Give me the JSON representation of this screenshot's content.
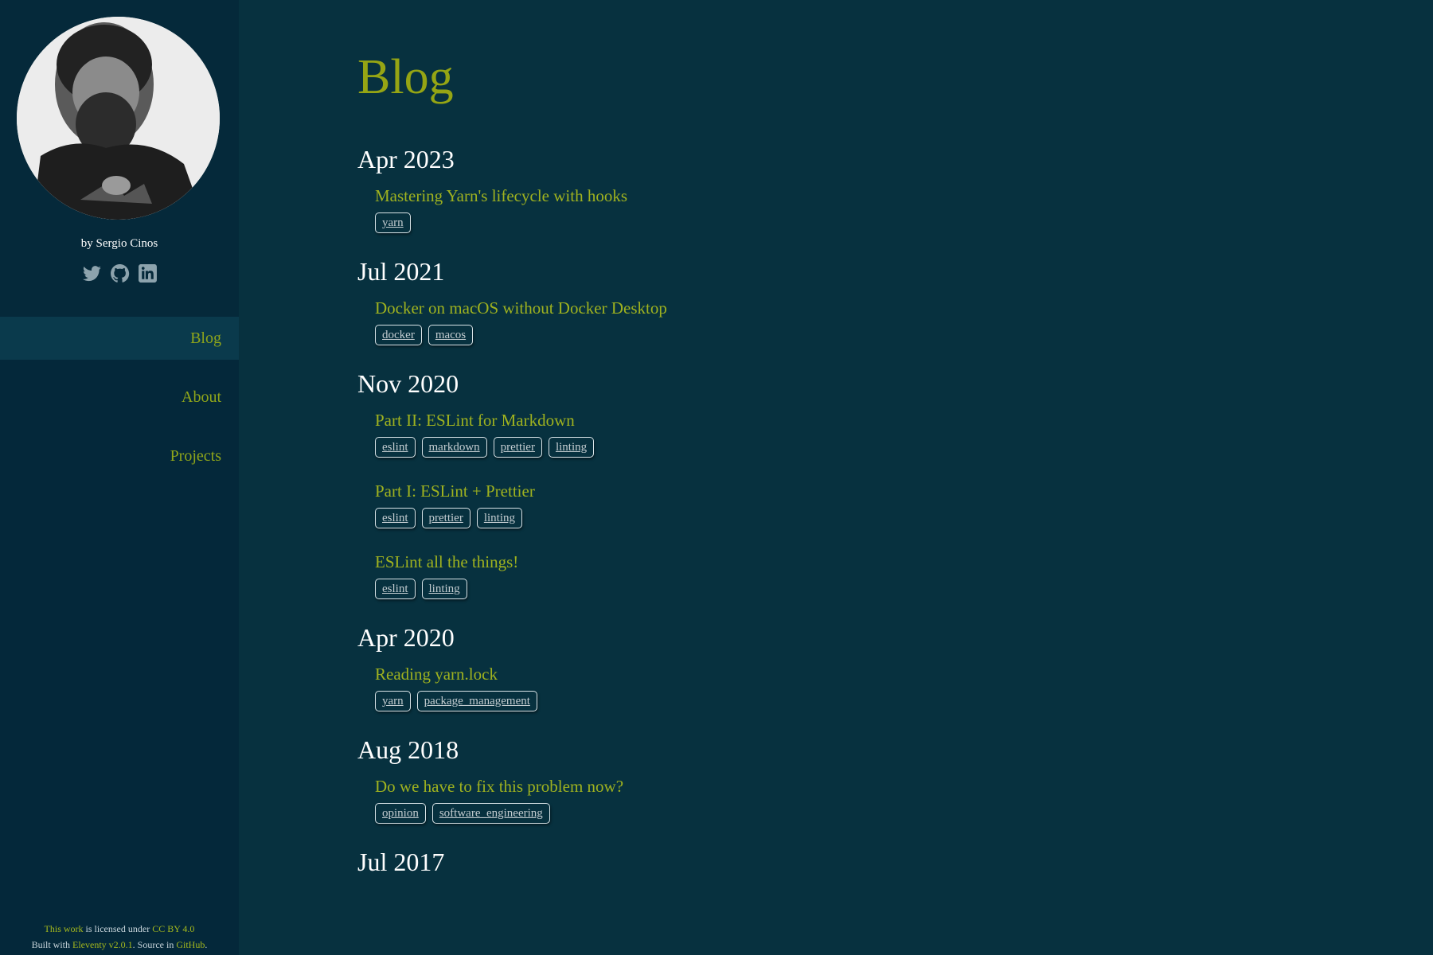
{
  "sidebar": {
    "byline": "by Sergio Cinos",
    "social": [
      "twitter-icon",
      "github-icon",
      "linkedin-icon"
    ],
    "nav": [
      {
        "label": "Blog",
        "active": true
      },
      {
        "label": "About",
        "active": false
      },
      {
        "label": "Projects",
        "active": false
      }
    ],
    "footer": {
      "this_work": "This work",
      "licensed": " is licensed under ",
      "license": "CC BY 4.0",
      "built_with": "Built with ",
      "eleventy": "Eleventy v2.0.1",
      "source_in": ". Source in ",
      "github": "GitHub",
      "end": "."
    }
  },
  "main": {
    "title": "Blog",
    "groups": [
      {
        "month": "Apr 2023",
        "posts": [
          {
            "title": "Mastering Yarn's lifecycle with hooks",
            "tags": [
              "yarn"
            ]
          }
        ]
      },
      {
        "month": "Jul 2021",
        "posts": [
          {
            "title": "Docker on macOS without Docker Desktop",
            "tags": [
              "docker",
              "macos"
            ]
          }
        ]
      },
      {
        "month": "Nov 2020",
        "posts": [
          {
            "title": "Part II: ESLint for Markdown",
            "tags": [
              "eslint",
              "markdown",
              "prettier",
              "linting"
            ]
          },
          {
            "title": "Part I: ESLint + Prettier",
            "tags": [
              "eslint",
              "prettier",
              "linting"
            ]
          },
          {
            "title": "ESLint all the things!",
            "tags": [
              "eslint",
              "linting"
            ]
          }
        ]
      },
      {
        "month": "Apr 2020",
        "posts": [
          {
            "title": "Reading yarn.lock",
            "tags": [
              "yarn",
              "package_management"
            ]
          }
        ]
      },
      {
        "month": "Aug 2018",
        "posts": [
          {
            "title": "Do we have to fix this problem now?",
            "tags": [
              "opinion",
              "software_engineering"
            ]
          }
        ]
      },
      {
        "month": "Jul 2017",
        "posts": []
      }
    ]
  },
  "colors": {
    "background": "#07313f",
    "sidebar": "#04283a",
    "accent": "#95a514",
    "text": "#ffffff"
  }
}
